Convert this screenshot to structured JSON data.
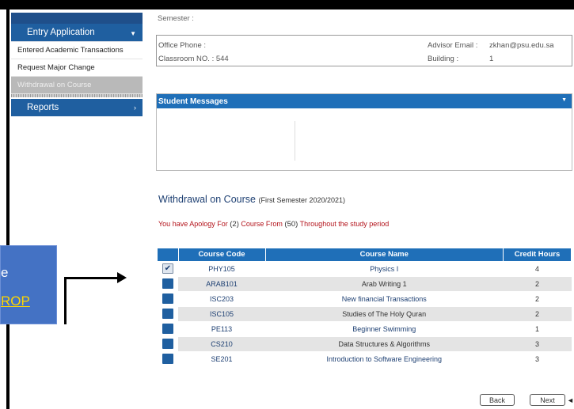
{
  "sidebar": {
    "entry_label": "Entry Application",
    "items": [
      {
        "label": "Entered Academic Transactions"
      },
      {
        "label": "Request Major Change"
      },
      {
        "label": "Withdrawal on Course"
      }
    ],
    "reports_label": "Reports"
  },
  "info": {
    "semester_label": "Semester :",
    "office_phone_label": "Office Phone :",
    "classroom_label": "Classroom NO. : 544",
    "advisor_email_label": "Advisor Email :",
    "advisor_email_value": "zkhan@psu.edu.sa",
    "building_label": "Building :",
    "building_value": "1"
  },
  "messages": {
    "title": "Student Messages"
  },
  "withdrawal": {
    "title": "Withdrawal on Course",
    "subtitle": "(First Semester 2020/2021)",
    "apology_prefix": "You have Apology For",
    "apology_count": "(2)",
    "apology_mid": "Course From",
    "apology_total": "(50)",
    "apology_suffix": "Throughout the study period"
  },
  "table": {
    "headers": [
      "Course Code",
      "Course Name",
      "Credit Hours"
    ],
    "rows": [
      {
        "code": "PHY105",
        "name": "Physics I",
        "credits": "4",
        "checked": true
      },
      {
        "code": "ARAB101",
        "name": "Arab Writing 1",
        "credits": "2",
        "checked": false
      },
      {
        "code": "ISC203",
        "name": "New financial Transactions",
        "credits": "2",
        "checked": false
      },
      {
        "code": "ISC105",
        "name": "Studies of The Holy Quran",
        "credits": "2",
        "checked": false
      },
      {
        "code": "PE113",
        "name": "Beginner Swimming",
        "credits": "1",
        "checked": false
      },
      {
        "code": "CS210",
        "name": "Data Structures & Algorithms",
        "credits": "3",
        "checked": false
      },
      {
        "code": "SE201",
        "name": "Introduction to Software Engineering",
        "credits": "3",
        "checked": false
      }
    ]
  },
  "buttons": {
    "back": "Back",
    "next": "Next"
  },
  "callout": {
    "line1": "e",
    "line2": "ROP"
  },
  "colors": {
    "accent": "#1f6fb8",
    "sidebar": "#1f5fa0",
    "warning_text": "#b3121a",
    "callout_bg": "#4472c4"
  }
}
